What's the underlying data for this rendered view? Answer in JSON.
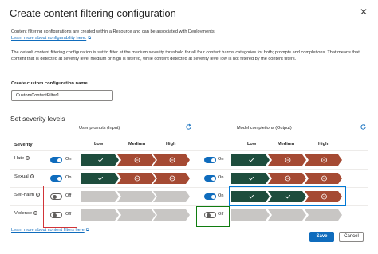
{
  "dialog": {
    "title": "Create content filtering configuration",
    "close_icon": "close-icon"
  },
  "intro": {
    "text": "Content filtering configurations are created within a Resource and can be associated with Deployments.",
    "link": "Learn more about configurability here."
  },
  "default_text": "The default content filtering configuration is set to filter at the medium severity threshold for all four content harms categories for both; prompts and completions. That means that content that is detected at severity level medium or high is filtered, while content detected at severity level low is not filtered by the content filters.",
  "config_name": {
    "label": "Create custom configuration name",
    "value": "CustomContentFilter1"
  },
  "severity": {
    "title": "Set severity levels",
    "severity_header": "Severity",
    "prompts_title": "User prompts (Input)",
    "completions_title": "Model completions (Output)",
    "levels": [
      "Low",
      "Medium",
      "High"
    ],
    "rows": [
      {
        "label": "Hate",
        "prompt": {
          "state": "On",
          "enabled": true,
          "marks": [
            "check",
            "block",
            "block"
          ]
        },
        "completion": {
          "state": "On",
          "enabled": true,
          "marks": [
            "check",
            "block",
            "block"
          ]
        }
      },
      {
        "label": "Sexual",
        "prompt": {
          "state": "On",
          "enabled": true,
          "marks": [
            "check",
            "block",
            "block"
          ]
        },
        "completion": {
          "state": "On",
          "enabled": true,
          "marks": [
            "check",
            "block",
            "block"
          ]
        }
      },
      {
        "label": "Self-harm",
        "prompt": {
          "state": "Off",
          "enabled": false,
          "marks": [
            "none",
            "none",
            "none"
          ]
        },
        "completion": {
          "state": "On",
          "enabled": true,
          "marks": [
            "check",
            "check",
            "block"
          ]
        }
      },
      {
        "label": "Violence",
        "prompt": {
          "state": "Off",
          "enabled": false,
          "marks": [
            "none",
            "none",
            "none"
          ]
        },
        "completion": {
          "state": "Off",
          "enabled": false,
          "marks": [
            "none",
            "none",
            "none"
          ]
        }
      }
    ]
  },
  "footer": {
    "link": "Learn more about content filters here",
    "save": "Save",
    "cancel": "Cancel"
  },
  "colors": {
    "allowed": "#1e4d3d",
    "blocked": "#a54a33",
    "disabled": "#c8c6c4",
    "toggle_on": "#0f6cbd",
    "accent": "#0f6cbd"
  }
}
